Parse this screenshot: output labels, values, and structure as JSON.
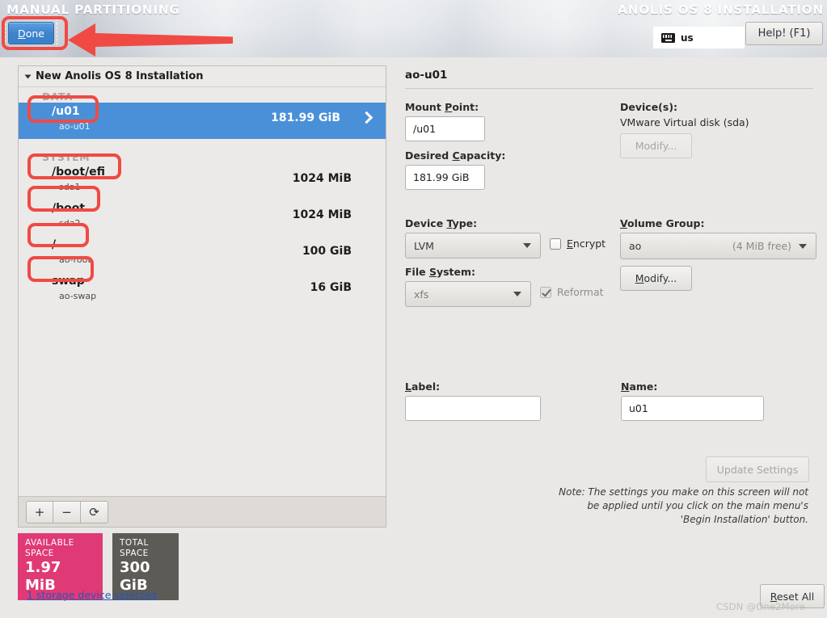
{
  "header": {
    "title": "MANUAL PARTITIONING",
    "distro_title": "ANOLIS OS 8 INSTALLATION",
    "done_label": "Done",
    "done_accel": "D",
    "done_rest": "one",
    "keyboard_layout": "us",
    "keyboard_icon": "keyboard-icon",
    "help_label": "Help! (F1)"
  },
  "left": {
    "page_title": "New Anolis OS 8 Installation",
    "groups": [
      {
        "label": "DATA",
        "rows": [
          {
            "mount": "/u01",
            "device": "ao-u01",
            "size": "181.99 GiB",
            "selected": true
          }
        ]
      },
      {
        "label": "SYSTEM",
        "rows": [
          {
            "mount": "/boot/efi",
            "device": "sda1",
            "size": "1024 MiB",
            "selected": false
          },
          {
            "mount": "/boot",
            "device": "sda2",
            "size": "1024 MiB",
            "selected": false
          },
          {
            "mount": "/",
            "device": "ao-root",
            "size": "100 GiB",
            "selected": false
          },
          {
            "mount": "swap",
            "device": "ao-swap",
            "size": "16 GiB",
            "selected": false
          }
        ]
      }
    ],
    "toolbar": {
      "add_label": "+",
      "remove_label": "−",
      "reset_label": "⟳"
    },
    "available_space_label": "AVAILABLE SPACE",
    "available_space_value": "1.97 MiB",
    "total_space_label": "TOTAL SPACE",
    "total_space_value": "300 GiB",
    "device_link": "1 storage device selected"
  },
  "detail": {
    "title": "ao-u01",
    "mount_point_label": "Mount Point:",
    "mount_point_accel": "P",
    "mount_point_value": "/u01",
    "desired_capacity_label": "Desired Capacity:",
    "desired_capacity_accel": "C",
    "desired_capacity_value": "181.99 GiB",
    "devices_label": "Device(s):",
    "devices_value": "VMware Virtual disk  (sda)",
    "modify_devices_label": "Modify...",
    "device_type_label": "Device Type:",
    "device_type_accel": "T",
    "device_type_value": "LVM",
    "encrypt_label": "Encrypt",
    "encrypt_accel": "E",
    "encrypt_checked": false,
    "file_system_label": "File System:",
    "file_system_accel": "S",
    "file_system_value": "xfs",
    "reformat_label": "Reformat",
    "reformat_checked": true,
    "volume_group_label": "Volume Group:",
    "volume_group_accel": "V",
    "volume_group_value": "ao",
    "volume_group_free": "(4 MiB free)",
    "modify_vg_label": "Modify...",
    "modify_vg_accel": "M",
    "label_label": "Label:",
    "label_accel": "L",
    "label_value": "",
    "name_label": "Name:",
    "name_accel": "N",
    "name_value": "u01",
    "update_settings_label": "Update Settings",
    "note": "Note:  The settings you make on this screen will not be applied until you click on the main menu's 'Begin Installation' button.",
    "reset_all_label": "Reset All",
    "reset_all_accel": "R"
  },
  "watermark": "CSDN @One2More"
}
